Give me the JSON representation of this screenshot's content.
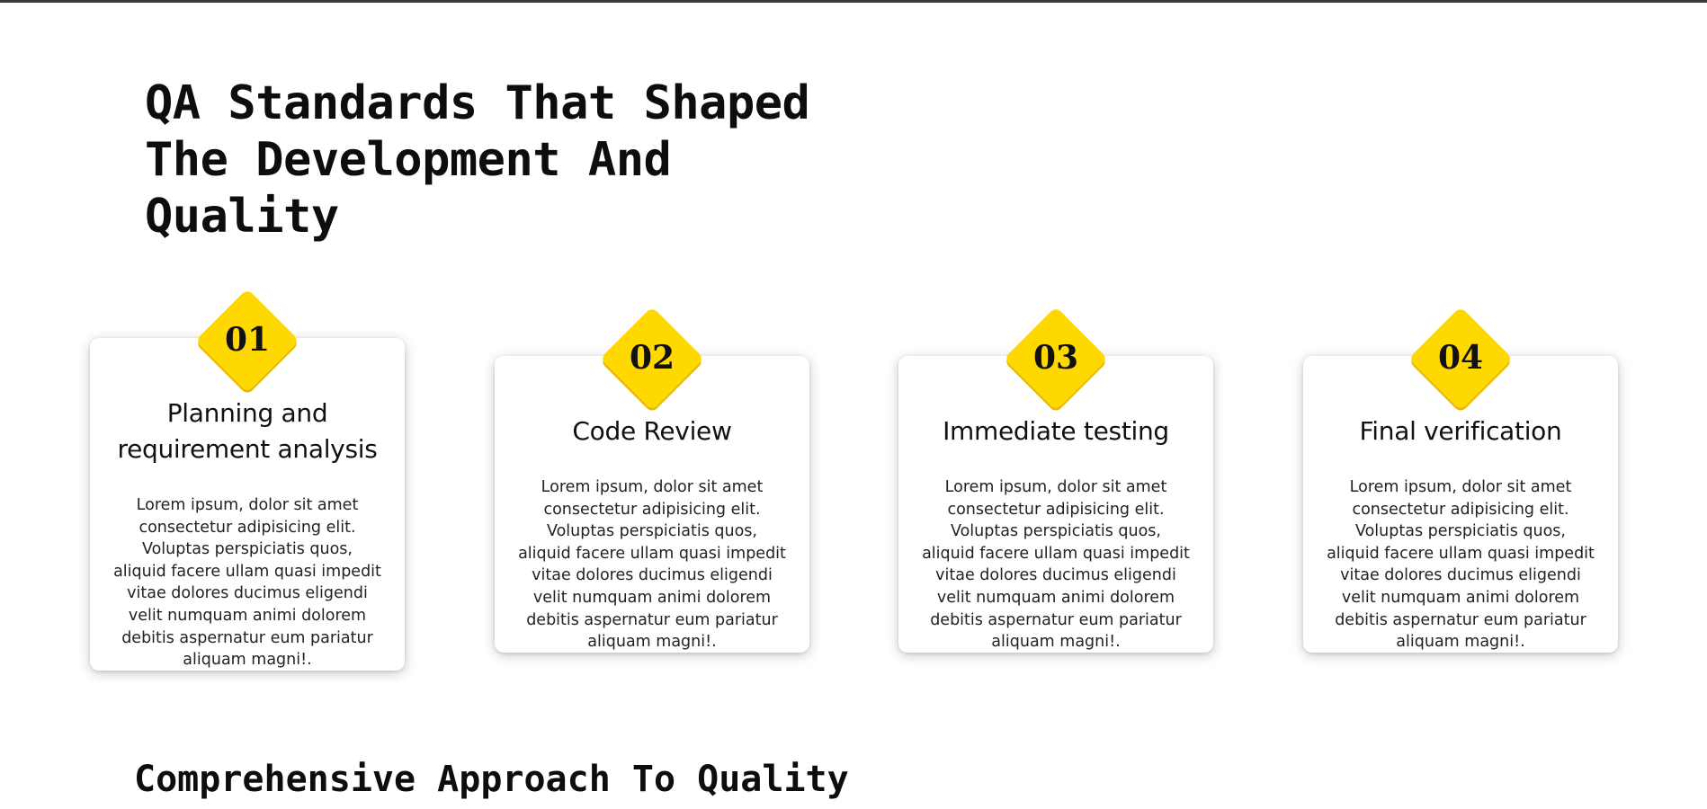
{
  "hero": {
    "title": "QA Standards That Shaped The Development And Quality"
  },
  "cards": [
    {
      "number": "01",
      "title": "Planning and requirement analysis",
      "body": "Lorem ipsum, dolor sit amet consectetur adipisicing elit. Voluptas perspiciatis quos, aliquid facere ullam quasi impedit vitae dolores ducimus eligendi velit numquam animi dolorem debitis aspernatur eum pariatur aliquam magni!."
    },
    {
      "number": "02",
      "title": "Code Review",
      "body": "Lorem ipsum, dolor sit amet consectetur adipisicing elit. Voluptas perspiciatis quos, aliquid facere ullam quasi impedit vitae dolores ducimus eligendi velit numquam animi dolorem debitis aspernatur eum pariatur aliquam magni!."
    },
    {
      "number": "03",
      "title": "Immediate testing",
      "body": "Lorem ipsum, dolor sit amet consectetur adipisicing elit. Voluptas perspiciatis quos, aliquid facere ullam quasi impedit vitae dolores ducimus eligendi velit numquam animi dolorem debitis aspernatur eum pariatur aliquam magni!."
    },
    {
      "number": "04",
      "title": "Final verification",
      "body": "Lorem ipsum, dolor sit amet consectetur adipisicing elit. Voluptas perspiciatis quos, aliquid facere ullam quasi impedit vitae dolores ducimus eligendi velit numquam animi dolorem debitis aspernatur eum pariatur aliquam magni!."
    }
  ],
  "section2": {
    "title": "Comprehensive Approach To Quality"
  },
  "colors": {
    "accent": "#ffd800",
    "card_background": "#ffffff",
    "text": "#111111",
    "top_rule": "#3a3a3a"
  }
}
